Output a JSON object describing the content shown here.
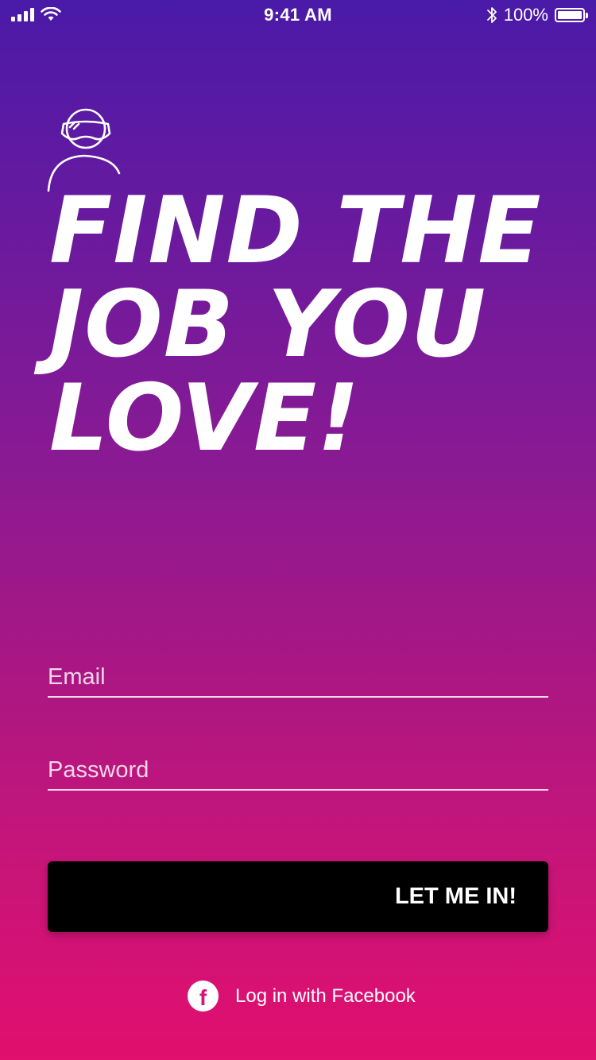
{
  "status_bar": {
    "time": "9:41 AM",
    "battery_percent": "100%",
    "battery_level": 1.0,
    "signal_bars": 4,
    "icons": [
      "signal-icon",
      "wifi-icon",
      "bluetooth-icon",
      "battery-icon"
    ]
  },
  "logo": {
    "icon": "vr-headset-person-icon"
  },
  "headline": {
    "line1": "FIND THE",
    "line2": "JOB YOU",
    "line3": "LOVE!"
  },
  "form": {
    "email_placeholder": "Email",
    "email_value": "",
    "password_placeholder": "Password",
    "password_value": "",
    "submit_label": "LET ME IN!"
  },
  "facebook_login": {
    "icon": "facebook-icon",
    "icon_letter": "f",
    "label": "Log in with Facebook"
  },
  "colors": {
    "gradient_top": "#4a1aa8",
    "gradient_bottom": "#e10f6e",
    "button_background": "#000000",
    "text": "#ffffff"
  }
}
